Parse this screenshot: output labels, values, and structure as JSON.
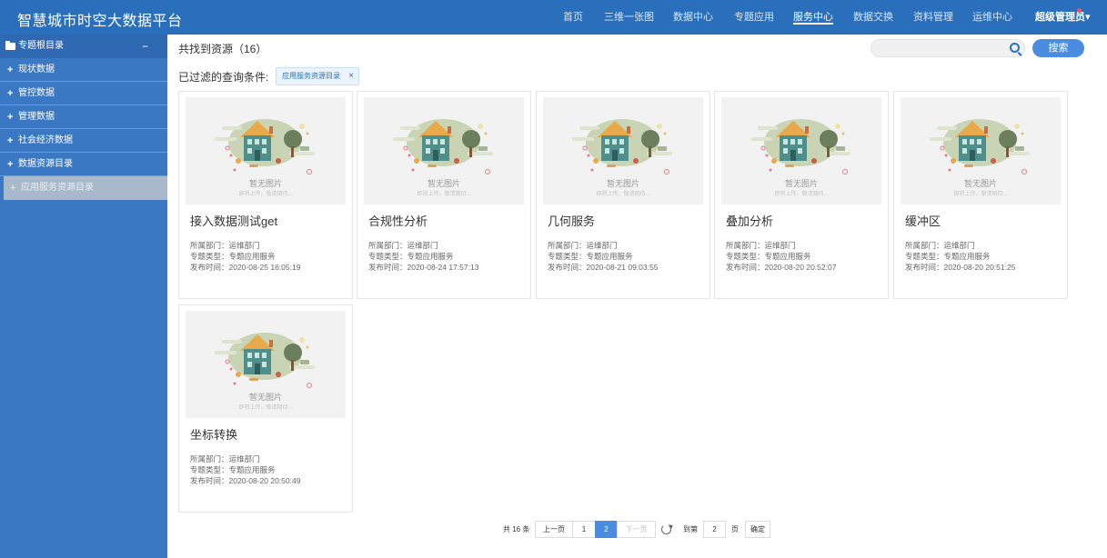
{
  "app": {
    "title": "智慧城市时空大数据平台"
  },
  "nav": {
    "items": [
      "首页",
      "三维一张图",
      "数据中心",
      "专题应用",
      "服务中心",
      "数据交换",
      "资料管理",
      "运维中心"
    ],
    "active": "服务中心",
    "user": "超级管理员▾"
  },
  "sidebar": {
    "root": "专题根目录",
    "collapse": "−",
    "items": [
      {
        "icon": "+",
        "label": "现状数据"
      },
      {
        "icon": "+",
        "label": "管控数据"
      },
      {
        "icon": "+",
        "label": "管理数据"
      },
      {
        "icon": "+",
        "label": "社会经济数据"
      },
      {
        "icon": "+",
        "label": "数据资源目录"
      },
      {
        "icon": "+",
        "label": "应用服务资源目录"
      }
    ]
  },
  "results": {
    "label": "共找到资源（16）"
  },
  "search": {
    "placeholder": "",
    "button": "搜索"
  },
  "filter": {
    "label": "已过滤的查询条件:",
    "tag": "应用服务资源目录",
    "remove": "×"
  },
  "card_common": {
    "noimg": "暂无图片",
    "hint": "即将上传，敬请期待..."
  },
  "cards": [
    {
      "title": "接入数据测试get",
      "dept": "所属部门：运维部门",
      "type": "专题类型：专题应用服务",
      "time": "发布时间：2020-08-25 16:05:19"
    },
    {
      "title": "合规性分析",
      "dept": "所属部门：运维部门",
      "type": "专题类型：专题应用服务",
      "time": "发布时间：2020-08-24 17:57:13"
    },
    {
      "title": "几何服务",
      "dept": "所属部门：运维部门",
      "type": "专题类型：专题应用服务",
      "time": "发布时间：2020-08-21 09:03:55"
    },
    {
      "title": "叠加分析",
      "dept": "所属部门：运维部门",
      "type": "专题类型：专题应用服务",
      "time": "发布时间：2020-08-20 20:52:07"
    },
    {
      "title": "缓冲区",
      "dept": "所属部门：运维部门",
      "type": "专题类型：专题应用服务",
      "time": "发布时间：2020-08-20 20:51:25"
    },
    {
      "title": "坐标转换",
      "dept": "所属部门：运维部门",
      "type": "专题类型：专题应用服务",
      "time": "发布时间：2020-08-20 20:50:49"
    }
  ],
  "pagination": {
    "total": "共 16 条",
    "prev": "上一页",
    "pages": [
      "1",
      "2"
    ],
    "current": "2",
    "next": "下一页",
    "goto_label": "到第",
    "goto_value": "2",
    "page_unit": "页",
    "confirm": "确定"
  },
  "colors": {
    "topbar": "#2a6fbb",
    "sidebar": "#3a78c4",
    "accent": "#4a8de0"
  }
}
